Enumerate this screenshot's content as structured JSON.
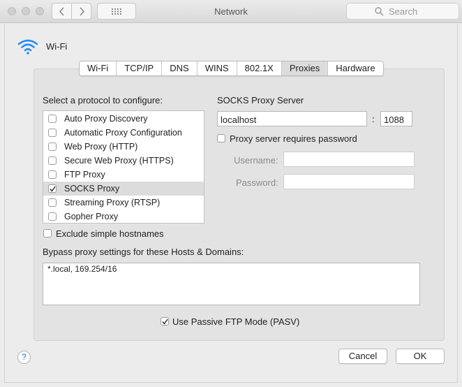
{
  "window": {
    "title": "Network",
    "search_placeholder": "Search"
  },
  "interface": {
    "name": "Wi-Fi"
  },
  "tabs": [
    {
      "label": "Wi-Fi"
    },
    {
      "label": "TCP/IP"
    },
    {
      "label": "DNS"
    },
    {
      "label": "WINS"
    },
    {
      "label": "802.1X"
    },
    {
      "label": "Proxies",
      "active": true
    },
    {
      "label": "Hardware"
    }
  ],
  "protocols": {
    "heading": "Select a protocol to configure:",
    "items": [
      {
        "label": "Auto Proxy Discovery",
        "checked": false
      },
      {
        "label": "Automatic Proxy Configuration",
        "checked": false
      },
      {
        "label": "Web Proxy (HTTP)",
        "checked": false
      },
      {
        "label": "Secure Web Proxy (HTTPS)",
        "checked": false
      },
      {
        "label": "FTP Proxy",
        "checked": false
      },
      {
        "label": "SOCKS Proxy",
        "checked": true,
        "selected": true
      },
      {
        "label": "Streaming Proxy (RTSP)",
        "checked": false
      },
      {
        "label": "Gopher Proxy",
        "checked": false
      }
    ]
  },
  "socks": {
    "heading": "SOCKS Proxy Server",
    "server": "localhost",
    "separator": ":",
    "port": "1088",
    "requires_password_label": "Proxy server requires password",
    "requires_password": false,
    "username_label": "Username:",
    "username": "",
    "password_label": "Password:",
    "password": ""
  },
  "exclude_simple_hostnames": {
    "label": "Exclude simple hostnames",
    "checked": false
  },
  "bypass": {
    "heading": "Bypass proxy settings for these Hosts & Domains:",
    "value": "*.local, 169.254/16"
  },
  "passive_ftp": {
    "label": "Use Passive FTP Mode (PASV)",
    "checked": true
  },
  "buttons": {
    "help": "?",
    "cancel": "Cancel",
    "ok": "OK"
  },
  "colors": {
    "accent": "#1a6fd8",
    "selected_row": "#dcdcdc"
  }
}
